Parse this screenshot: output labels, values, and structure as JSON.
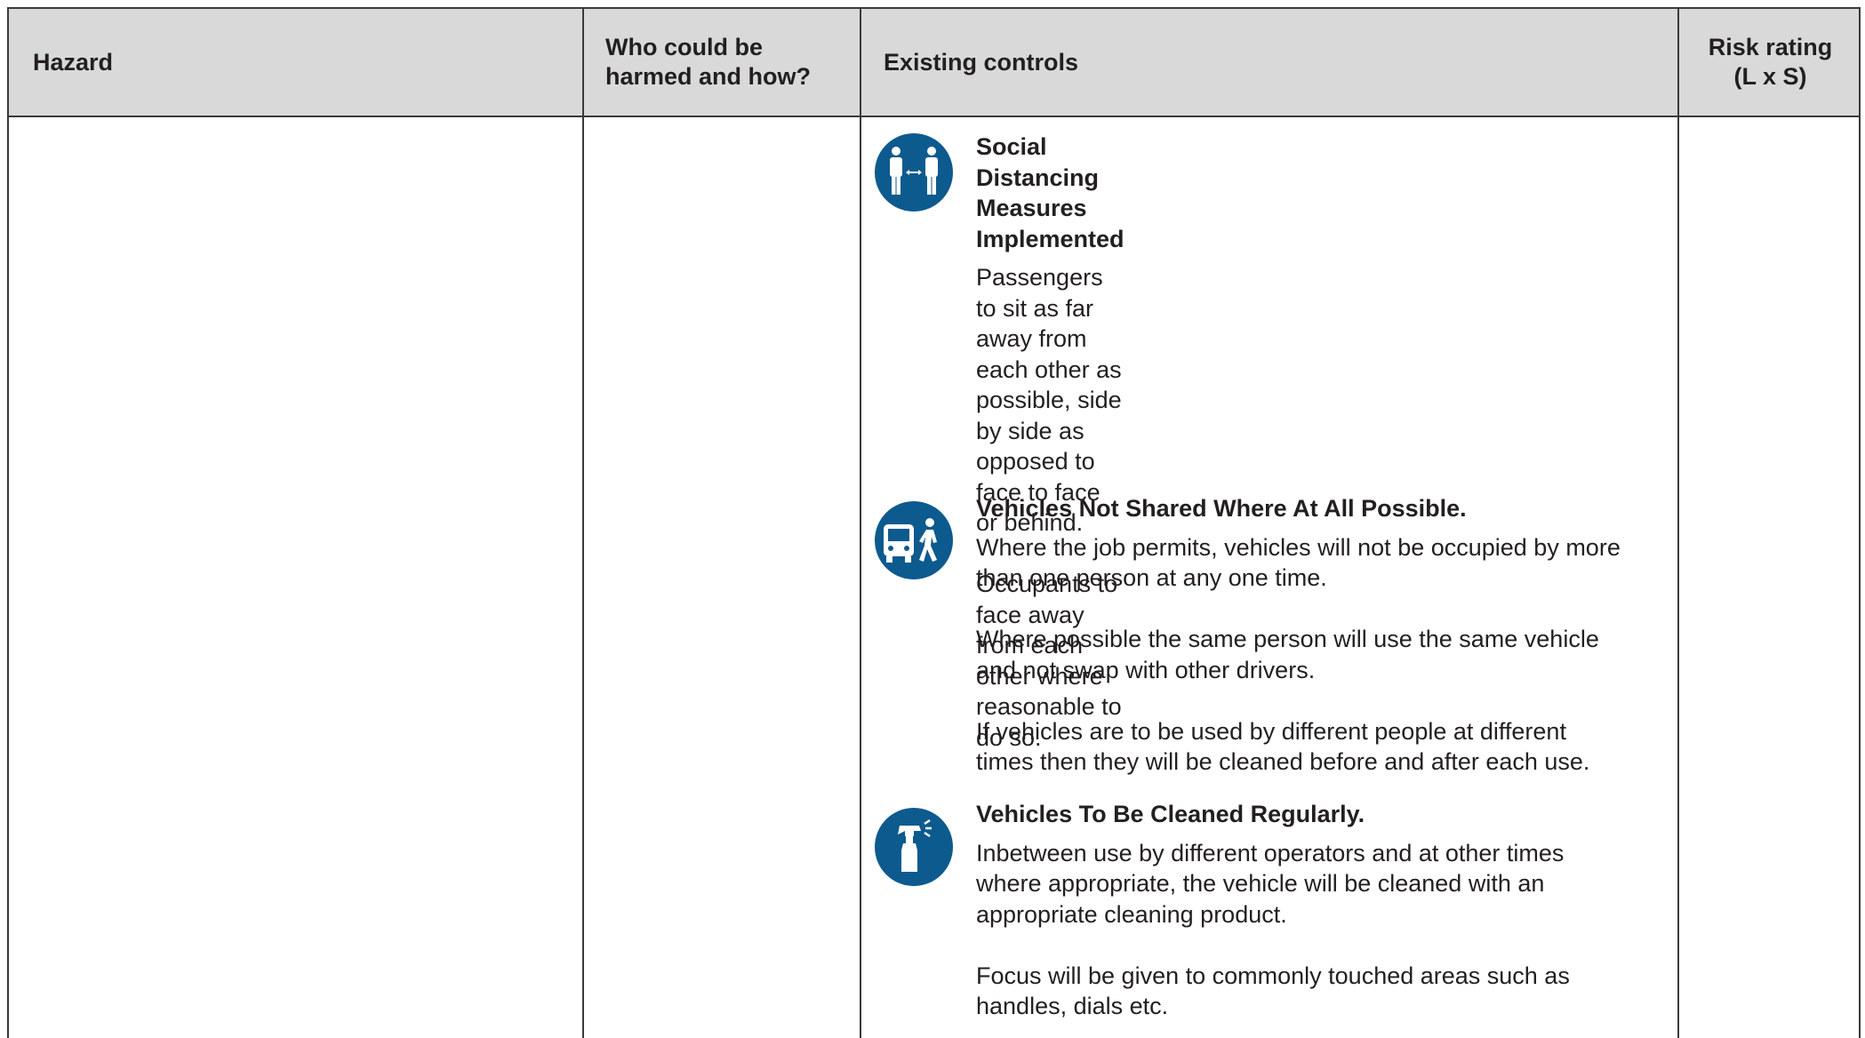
{
  "header": {
    "hazard": "Hazard",
    "who_line1": "Who could be",
    "who_line2": "harmed and how?",
    "existing_controls": "Existing controls",
    "risk_line1": "Risk rating",
    "risk_line2": "(L x S)"
  },
  "controls": [
    {
      "icon": "social-distancing-icon",
      "title_lines": [
        "Social Distancing",
        "Measures Implemented"
      ],
      "para1_lines": [
        "Passengers to sit as far",
        "away from each other as",
        "possible, side by side as",
        "opposed to face to face",
        "or behind."
      ],
      "para2_lines": [
        "Occupants to face away",
        "from each other where",
        "reasonable to do so."
      ]
    },
    {
      "icon": "vehicle-pedestrian-icon",
      "title": "Vehicles Not Shared Where At All Possible.",
      "para1_lines": [
        "Where the job permits, vehicles will not be occupied by more",
        "than one person at any one time."
      ],
      "para2_lines": [
        "Where possible the same person will use the same vehicle",
        "and not swap with other drivers."
      ],
      "para3_lines": [
        "If vehicles are to be used by different people at different",
        "times then they will be cleaned before and after each use."
      ]
    },
    {
      "icon": "spray-bottle-icon",
      "title": "Vehicles To Be Cleaned Regularly.",
      "para1_lines": [
        "Inbetween use by different operators and at other times",
        "where appropriate, the vehicle will be cleaned with an",
        "appropriate cleaning product."
      ],
      "para2_lines": [
        "Focus will be given to commonly touched areas such as",
        "handles, dials etc."
      ]
    }
  ],
  "colors": {
    "header_bg": "#d9d9d9",
    "icon_blue": "#0d5a8f",
    "border": "#3a3a3a"
  }
}
